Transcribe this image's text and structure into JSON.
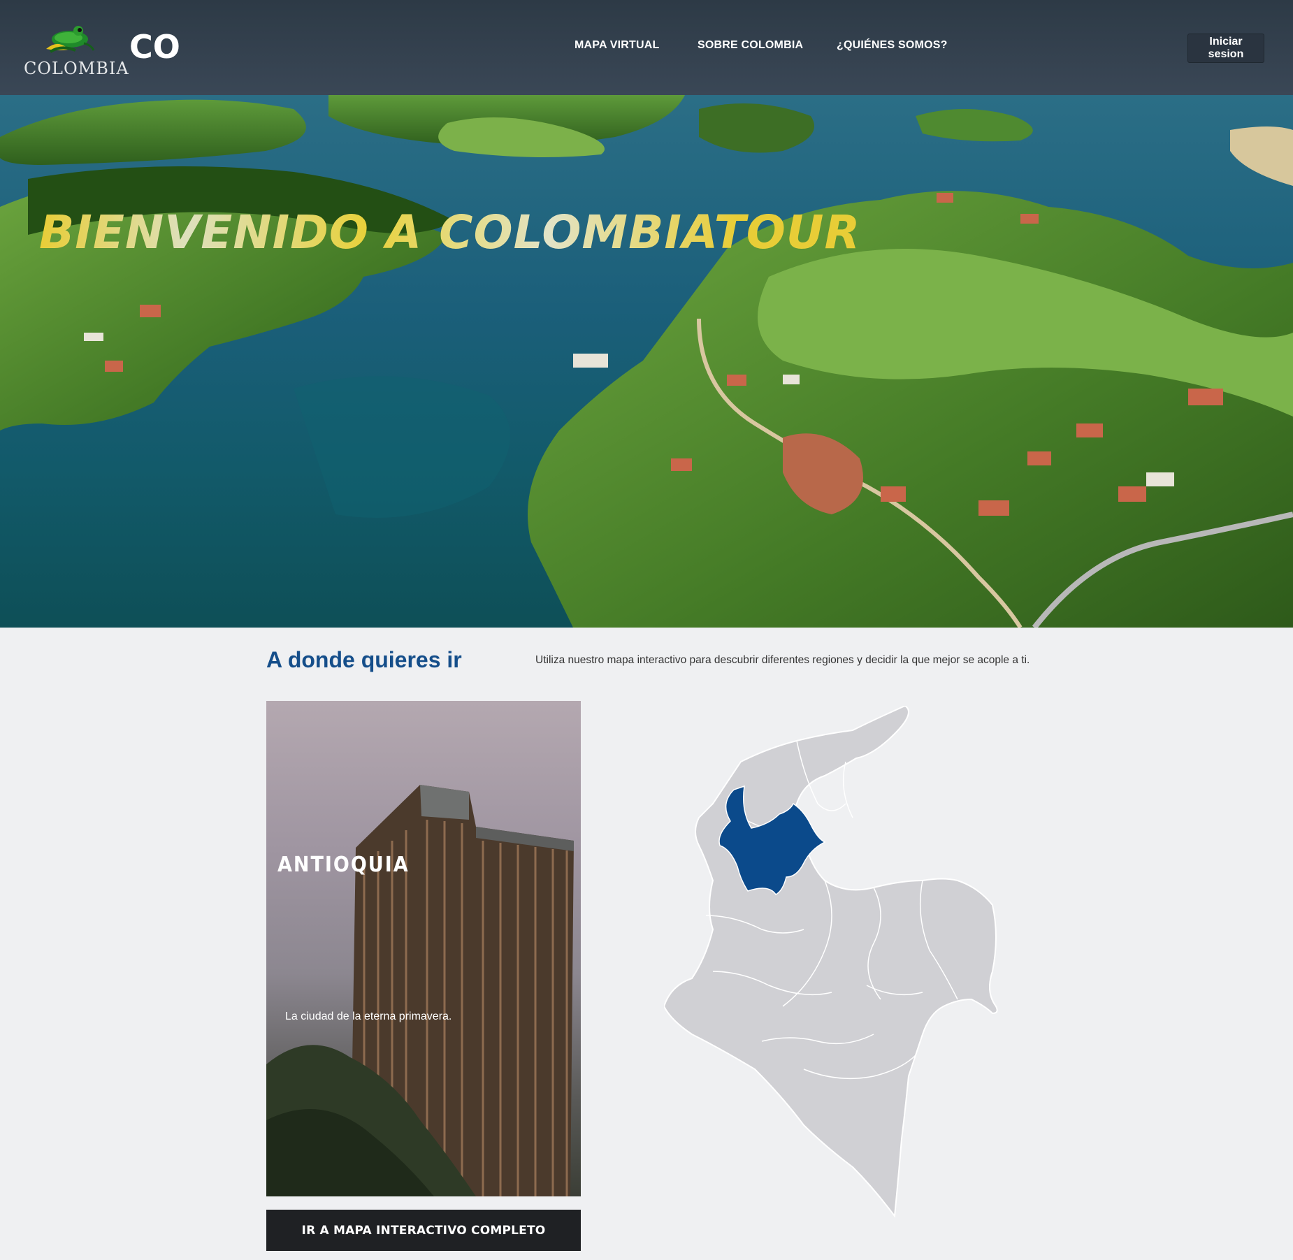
{
  "header": {
    "logo_text": "COLOMBIA",
    "brand": "CO",
    "nav": [
      "MAPA VIRTUAL",
      "SOBRE COLOMBIA",
      "¿QUIÉNES SOMOS?"
    ],
    "login_label": "Iniciar sesion"
  },
  "hero": {
    "title": "BIENVENIDO A COLOMBIATOUR"
  },
  "explore": {
    "title": "A donde quieres ir",
    "description": "Utiliza nuestro mapa interactivo para descubrir diferentes regiones y decidir la que mejor se acople a ti.",
    "card": {
      "region": "ANTIOQUIA",
      "tagline": "La ciudad de la eterna primavera."
    },
    "cta_label": "IR A MAPA INTERACTIVO COMPLETO",
    "map": {
      "highlighted_region": "Antioquia",
      "highlight_color": "#0b4a8b",
      "base_color": "#d0d0d4"
    }
  }
}
